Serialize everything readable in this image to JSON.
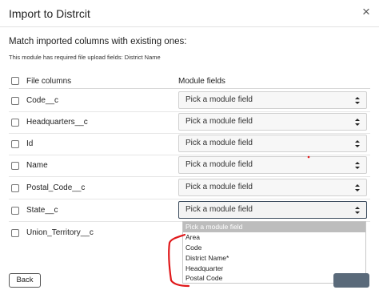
{
  "dialog": {
    "title": "Import to Distrcit",
    "close_glyph": "×",
    "subtitle": "Match imported columns with existing ones:",
    "note": "This module has required file upload fields: District Name"
  },
  "table": {
    "headers": {
      "file_columns": "File columns",
      "module_fields": "Module fields"
    },
    "rows": [
      {
        "column": "Code__c",
        "field": "Pick a module field"
      },
      {
        "column": "Headquarters__c",
        "field": "Pick a module field"
      },
      {
        "column": "Id",
        "field": "Pick a module field"
      },
      {
        "column": "Name",
        "field": "Pick a module field"
      },
      {
        "column": "Postal_Code__c",
        "field": "Pick a module field"
      },
      {
        "column": "State__c",
        "field": "Pick a module field"
      },
      {
        "column": "Union_Territory__c",
        "field": ""
      }
    ]
  },
  "dropdown": {
    "options": [
      "Pick a module field",
      "Area",
      "Code",
      "District Name*",
      "Headquarter",
      "Postal Code"
    ],
    "highlighted_index": 0
  },
  "footer": {
    "back_label": "Back"
  },
  "colors": {
    "annotation": "#e0191b",
    "active_border": "#3a4a5c",
    "highlight": "#bdbdbd"
  },
  "icons": {
    "select_arrows": "chevron-up-down-icon",
    "close": "close-icon"
  }
}
